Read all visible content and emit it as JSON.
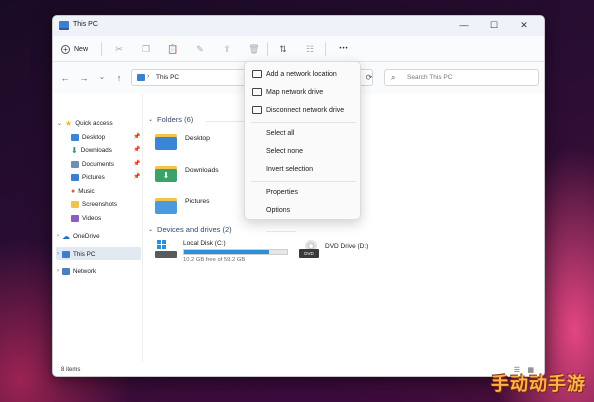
{
  "window": {
    "title": "This PC",
    "minimize_glyph": "—",
    "maximize_glyph": "☐",
    "close_glyph": "✕"
  },
  "toolbar": {
    "new_label": "New",
    "more_glyph": "•••"
  },
  "address": {
    "path": "This PC",
    "search_placeholder": "Search This PC"
  },
  "sidebar": {
    "items": [
      {
        "label": "Quick access",
        "icon": "star-icon"
      },
      {
        "label": "Desktop",
        "icon": "desktop-folder-icon"
      },
      {
        "label": "Downloads",
        "icon": "downloads-folder-icon"
      },
      {
        "label": "Documents",
        "icon": "documents-folder-icon"
      },
      {
        "label": "Pictures",
        "icon": "pictures-folder-icon"
      },
      {
        "label": "Music",
        "icon": "music-folder-icon"
      },
      {
        "label": "Screenshots",
        "icon": "folder-icon"
      },
      {
        "label": "Videos",
        "icon": "videos-folder-icon"
      },
      {
        "label": "OneDrive",
        "icon": "cloud-icon"
      },
      {
        "label": "This PC",
        "icon": "computer-icon"
      },
      {
        "label": "Network",
        "icon": "network-icon"
      }
    ]
  },
  "main": {
    "folders_header": "Folders (6)",
    "folders": [
      {
        "label": "Desktop",
        "icon": "desktop-folder-icon"
      },
      {
        "label": "Downloads",
        "icon": "downloads-folder-icon"
      },
      {
        "label": "Pictures",
        "icon": "pictures-folder-icon"
      }
    ],
    "drives_header": "Devices and drives (2)",
    "drives": [
      {
        "label": "Local Disk (C:)",
        "sub": "10.2 GB free of 59.2 GB",
        "used_fraction": 0.83
      },
      {
        "label": "DVD Drive (D:)",
        "badge": "DVD"
      }
    ]
  },
  "context_menu": {
    "items": [
      {
        "label": "Add a network location",
        "icon": "network-location-icon"
      },
      {
        "label": "Map network drive",
        "icon": "map-drive-icon"
      },
      {
        "label": "Disconnect network drive",
        "icon": "disconnect-drive-icon"
      },
      {
        "label": "Select all"
      },
      {
        "label": "Select none"
      },
      {
        "label": "Invert selection"
      },
      {
        "label": "Properties"
      },
      {
        "label": "Options"
      }
    ]
  },
  "status": {
    "items_count": "8 items"
  },
  "watermark": "手动动手游",
  "colors": {
    "accent": "#2b8fd9",
    "folder": "#f4c34b",
    "selected_bg": "#e1e9f3"
  }
}
